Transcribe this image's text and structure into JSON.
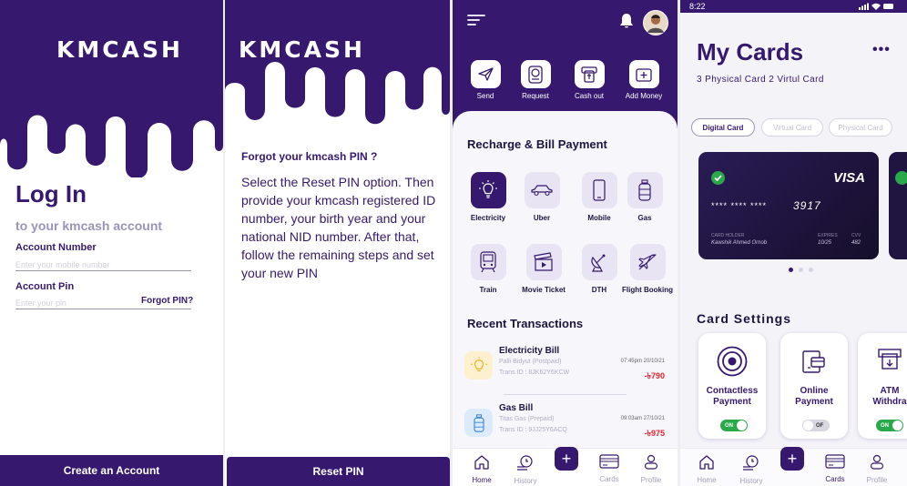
{
  "login": {
    "logo": "KMCASH",
    "title": "Log In",
    "subtitle": "to your kmcash account",
    "account_number_label": "Account Number",
    "account_number_placeholder": "Enter your mobile number",
    "pin_label": "Account Pin",
    "pin_placeholder": "Enter your pin",
    "forgot_pin": "Forgot PIN?",
    "create_account": "Create an Account"
  },
  "reset": {
    "logo": "KMCASH",
    "question": "Forgot your kmcash PIN ?",
    "instructions": "Select the Reset PIN option. Then provide your kmcash registered ID number, your birth year and your national NID number. After that, follow the remaining steps and set your new PIN",
    "button": "Reset PIN"
  },
  "home": {
    "quick_actions": [
      {
        "label": "Send",
        "icon": "send-icon"
      },
      {
        "label": "Request",
        "icon": "request-icon"
      },
      {
        "label": "Cash out",
        "icon": "cash-out-icon"
      },
      {
        "label": "Add Money",
        "icon": "add-money-icon"
      }
    ],
    "bill_section_title": "Recharge & Bill Payment",
    "services": [
      {
        "label": "Electricity",
        "icon": "bulb-icon"
      },
      {
        "label": "Uber",
        "icon": "car-icon"
      },
      {
        "label": "Mobile",
        "icon": "phone-icon"
      },
      {
        "label": "Gas",
        "icon": "gas-cylinder-icon"
      },
      {
        "label": "Train",
        "icon": "train-icon"
      },
      {
        "label": "Movie Ticket",
        "icon": "clapperboard-icon"
      },
      {
        "label": "DTH",
        "icon": "satellite-dish-icon"
      },
      {
        "label": "Flight Booking",
        "icon": "plane-icon"
      }
    ],
    "transactions_title": "Recent Transactions",
    "transactions": [
      {
        "name": "Electricity Bill",
        "provider": "Palli Bidyut (Postpaid)",
        "trans_id": "Trans ID : 8JK62Y6KCW",
        "datetime": "07:45pm 20/10/21",
        "amount": "-৳790",
        "icon": "bulb-icon",
        "icon_bg": "#fdf0cf"
      },
      {
        "name": "Gas Bill",
        "provider": "Titas Gas (Prepaid)",
        "trans_id": "Trans ID : 9JJ25Y6ACQ",
        "datetime": "09:03am 27/10/21",
        "amount": "-৳975",
        "icon": "gas-cylinder-icon",
        "icon_bg": "#dcebfb"
      }
    ],
    "nav": [
      {
        "label": "Home",
        "icon": "home-icon"
      },
      {
        "label": "History",
        "icon": "history-icon"
      },
      {
        "label": "",
        "icon": "plus-icon"
      },
      {
        "label": "Cards",
        "icon": "cards-icon"
      },
      {
        "label": "Profile",
        "icon": "profile-icon"
      }
    ]
  },
  "cards": {
    "time": "8:22",
    "title": "My Cards",
    "subtitle": "3 Physical Card 2 Virtul Card",
    "tabs": [
      "Digital Card",
      "Virtual Card",
      "Physical Card"
    ],
    "active_tab": "Digital Card",
    "card": {
      "brand": "VISA",
      "number": "**** **** ****",
      "last4": "3917",
      "holder_label": "CARD HOLDER",
      "holder": "Kawshik Ahmed Ornob",
      "expires_label": "EXPIRES",
      "expires": "10/25",
      "cvv_label": "CVV",
      "cvv": "482"
    },
    "settings_title": "Card Settings",
    "settings": [
      {
        "label": "Contactless\nPayment",
        "toggle": "ON",
        "icon": "contactless-icon"
      },
      {
        "label": "Online\nPayment",
        "toggle": "OF",
        "icon": "online-payment-icon"
      },
      {
        "label": "ATM\nWithdra",
        "toggle": "ON",
        "icon": "atm-icon"
      }
    ],
    "nav": [
      {
        "label": "Home",
        "icon": "home-icon"
      },
      {
        "label": "History",
        "icon": "history-icon"
      },
      {
        "label": "",
        "icon": "plus-icon"
      },
      {
        "label": "Cards",
        "icon": "cards-icon"
      },
      {
        "label": "Profile",
        "icon": "profile-icon"
      }
    ]
  },
  "colors": {
    "primary": "#36196e",
    "negative": "#e5252a",
    "toggle_on": "#29a94a"
  }
}
